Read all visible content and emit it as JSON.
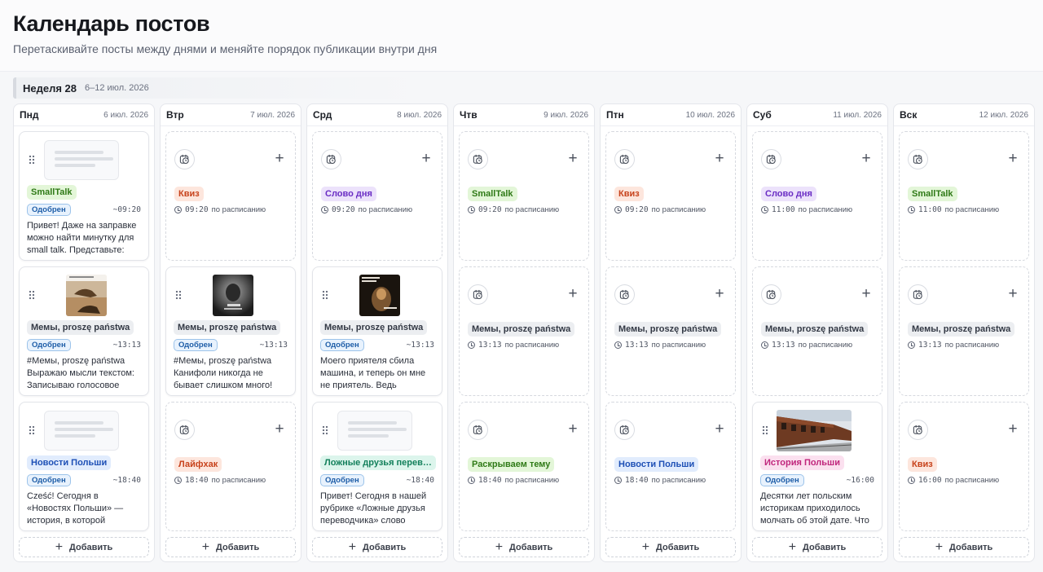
{
  "page": {
    "title": "Календарь постов",
    "subtitle": "Перетаскивайте посты между днями и меняйте порядок публикации внутри дня"
  },
  "week": {
    "label": "Неделя 28",
    "range": "6–12 июл. 2026"
  },
  "scheduled_suffix": "по расписанию",
  "add_label": "Добавить",
  "days": [
    {
      "day": "Пнд",
      "date": "6 июл. 2026",
      "slots": [
        {
          "type": "post",
          "thumb": "text",
          "tag": "SmallTalk",
          "tag_color": "green",
          "status": "Одобрен",
          "time": "09:20",
          "text": "Привет! Даже на заправке можно найти минутку для small talk. Представьте:"
        },
        {
          "type": "post",
          "thumb": "image",
          "tag": "Мемы, proszę państwa",
          "tag_color": "gray",
          "status": "Одобрен",
          "time": "13:13",
          "text": "#Мемы, proszę państwa Выражаю мысли текстом: Записываю голосовое"
        },
        {
          "type": "post",
          "thumb": "text",
          "tag": "Новости Польши",
          "tag_color": "blue",
          "status": "Одобрен",
          "time": "18:40",
          "text": "Cześć! Сегодня в «Новостях Польши» — история, в которой"
        }
      ]
    },
    {
      "day": "Втр",
      "date": "7 июл. 2026",
      "slots": [
        {
          "type": "empty",
          "tag": "Квиз",
          "tag_color": "orange",
          "time": "09:20"
        },
        {
          "type": "post",
          "thumb": "image",
          "tag": "Мемы, proszę państwa",
          "tag_color": "gray",
          "status": "Одобрен",
          "time": "13:13",
          "text": "#Мемы, proszę państwa Канифоли никогда не бывает слишком много!"
        },
        {
          "type": "empty",
          "tag": "Лайфхак",
          "tag_color": "orange",
          "time": "18:40"
        }
      ]
    },
    {
      "day": "Срд",
      "date": "8 июл. 2026",
      "slots": [
        {
          "type": "empty",
          "tag": "Слово дня",
          "tag_color": "purple",
          "time": "09:20"
        },
        {
          "type": "post",
          "thumb": "image",
          "tag": "Мемы, proszę państwa",
          "tag_color": "gray",
          "status": "Одобрен",
          "time": "13:13",
          "text": "Моего приятеля сбила машина, и теперь он мне не приятель. Ведь"
        },
        {
          "type": "post",
          "thumb": "text",
          "tag": "Ложные друзья перев…",
          "tag_color": "mint",
          "status": "Одобрен",
          "time": "18:40",
          "text": "Привет! Сегодня в нашей рубрике «Ложные друзья переводчика» слово"
        }
      ]
    },
    {
      "day": "Чтв",
      "date": "9 июл. 2026",
      "slots": [
        {
          "type": "empty",
          "tag": "SmallTalk",
          "tag_color": "green",
          "time": "09:20"
        },
        {
          "type": "empty",
          "tag": "Мемы, proszę państwa",
          "tag_color": "gray",
          "time": "13:13"
        },
        {
          "type": "empty",
          "tag": "Раскрываем тему",
          "tag_color": "green",
          "time": "18:40"
        }
      ]
    },
    {
      "day": "Птн",
      "date": "10 июл. 2026",
      "slots": [
        {
          "type": "empty",
          "tag": "Квиз",
          "tag_color": "orange",
          "time": "09:20"
        },
        {
          "type": "empty",
          "tag": "Мемы, proszę państwa",
          "tag_color": "gray",
          "time": "13:13"
        },
        {
          "type": "empty",
          "tag": "Новости Польши",
          "tag_color": "blue",
          "time": "18:40"
        }
      ]
    },
    {
      "day": "Суб",
      "date": "11 июл. 2026",
      "slots": [
        {
          "type": "empty",
          "tag": "Слово дня",
          "tag_color": "purple",
          "time": "11:00"
        },
        {
          "type": "empty",
          "tag": "Мемы, proszę państwa",
          "tag_color": "gray",
          "time": "13:13"
        },
        {
          "type": "post",
          "thumb": "wide",
          "tag": "История Польши",
          "tag_color": "pink",
          "status": "Одобрен",
          "time": "16:00",
          "text": "Десятки лет польским историкам приходилось молчать об этой дате. Что"
        }
      ]
    },
    {
      "day": "Вск",
      "date": "12 июл. 2026",
      "slots": [
        {
          "type": "empty",
          "tag": "SmallTalk",
          "tag_color": "green",
          "time": "11:00"
        },
        {
          "type": "empty",
          "tag": "Мемы, proszę państwa",
          "tag_color": "gray",
          "time": "13:13"
        },
        {
          "type": "empty",
          "tag": "Квиз",
          "tag_color": "orange",
          "time": "16:00"
        }
      ]
    }
  ],
  "icons": {
    "calendar": "calendar-clock-icon",
    "plus": "plus-icon",
    "drag": "drag-handle-icon",
    "clock": "clock-icon"
  }
}
